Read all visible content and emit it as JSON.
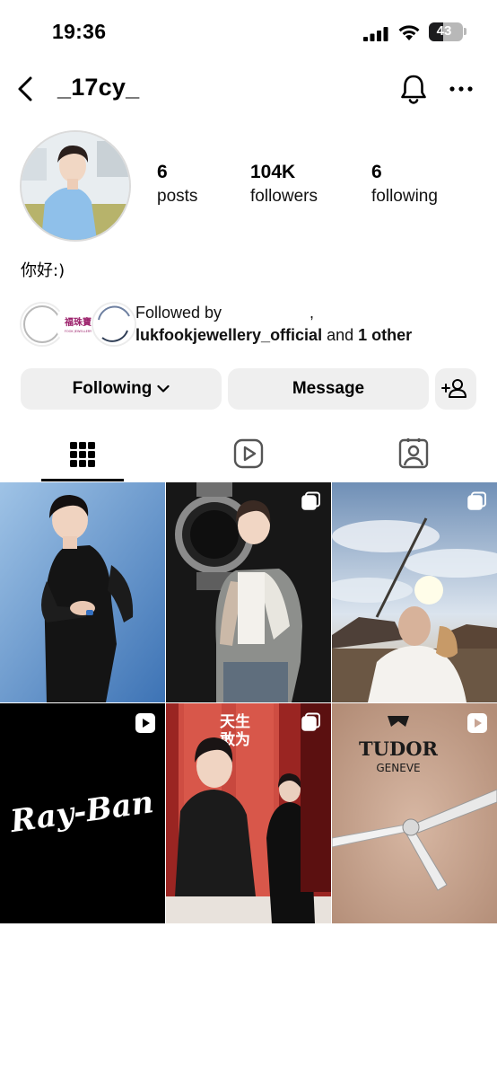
{
  "status_bar": {
    "time": "19:36",
    "battery": "43",
    "battery_level": 0.43
  },
  "header": {
    "username": "_17cy_"
  },
  "profile": {
    "stats": [
      {
        "value": "6",
        "label": "posts"
      },
      {
        "value": "104K",
        "label": "followers"
      },
      {
        "value": "6",
        "label": "following"
      }
    ],
    "bio": "你好:)"
  },
  "mutual": {
    "line1": "Followed by",
    "comma": ",",
    "account": "lukfookjewellery_official",
    "and": "and",
    "others": "1 other",
    "logo_cn": "福珠寶",
    "logo_en": "FOOK JEWELLERY"
  },
  "actions": {
    "following": "Following",
    "message": "Message"
  },
  "tabs": [
    "posts-grid",
    "reels",
    "tagged"
  ],
  "posts": {
    "rayban_logo": "Ray-Ban",
    "tudor_logo": "TUDOR",
    "tudor_sub": "GENEVE",
    "poster_text": "天生\n敢为"
  }
}
